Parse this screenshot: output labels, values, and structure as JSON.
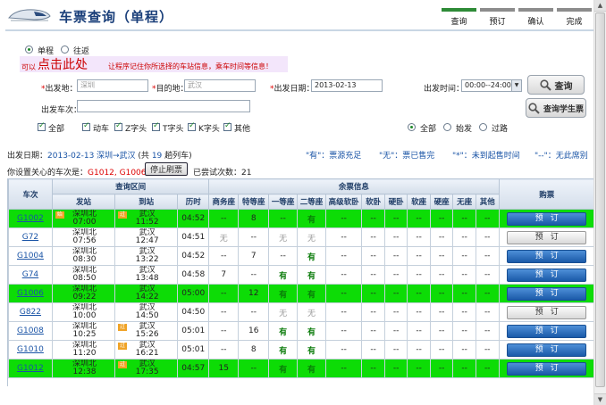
{
  "header": {
    "title": "车票查询（单程）",
    "steps": [
      "查询",
      "预订",
      "确认",
      "完成"
    ],
    "active_step": 0,
    "active_color": "#2e8b37"
  },
  "form": {
    "trip_one_way": "单程",
    "trip_round": "往返",
    "banner_prefix": "可以",
    "banner_big": "点击此处",
    "banner_rest": "让程序记住你所选择的车站信息，乘车时间等信息！",
    "from_label": "出发地：",
    "from_value": "深圳",
    "to_label": "目的地：",
    "to_value": "武汉",
    "date_label": "出发日期：",
    "date_value": "2013-02-13",
    "time_label": "出发时间：",
    "time_value": "00:00--24:00",
    "train_label": "出发车次：",
    "train_value": "",
    "query_button": "查询",
    "student_button": "查询学生票",
    "types": [
      "全部",
      "动车",
      "Z字头",
      "T字头",
      "K字头",
      "其他"
    ],
    "passing": [
      "全部",
      "始发",
      "过路"
    ]
  },
  "info": {
    "date_label": "出发日期：",
    "date_value": "2013-02-13",
    "route": "深圳→武汉",
    "count_prefix": "(共",
    "count": "19",
    "count_suffix": "趟列车)",
    "legend_have": "\"有\"：票源充足",
    "legend_none": "\"无\"：票已售完",
    "legend_star": "\"*\"：未到起售时间",
    "legend_dash": "\"--\"：无此席别",
    "watch_label": "你设置关心的车次是：",
    "watch_value": "G1012, G1006, G1002",
    "stop_button": "停止刷票",
    "tries_label": "已尝试次数：",
    "tries_value": "21"
  },
  "table": {
    "headers": {
      "train": "车次",
      "interval": "查询区间",
      "depart": "发站",
      "arrive": "到站",
      "duration": "历时",
      "seats_group": "余票信息",
      "book": "购票"
    },
    "seat_cols": [
      "商务座",
      "特等座",
      "一等座",
      "二等座",
      "高级软卧",
      "软卧",
      "硬卧",
      "软座",
      "硬座",
      "无座",
      "其他"
    ],
    "start_badge": "始",
    "pass_badge": "过",
    "book_label": "预订",
    "rows": [
      {
        "no": "G1002",
        "from": "深圳北",
        "dep": "07:00",
        "to": "武汉",
        "arr": "11:52",
        "dur": "04:52",
        "seats": [
          "--",
          "8",
          "--",
          "有",
          "--",
          "--",
          "--",
          "--",
          "--",
          "--",
          "--"
        ],
        "green": true
      },
      {
        "no": "G72",
        "from": "深圳北",
        "dep": "07:56",
        "to": "武汉",
        "arr": "12:47",
        "dur": "04:51",
        "seats": [
          "无",
          "--",
          "无",
          "无",
          "--",
          "--",
          "--",
          "--",
          "--",
          "--",
          "--"
        ],
        "green": false
      },
      {
        "no": "G1004",
        "from": "深圳北",
        "dep": "08:30",
        "to": "武汉",
        "arr": "13:22",
        "dur": "04:52",
        "seats": [
          "--",
          "7",
          "--",
          "有",
          "--",
          "--",
          "--",
          "--",
          "--",
          "--",
          "--"
        ],
        "green": false
      },
      {
        "no": "G74",
        "from": "深圳北",
        "dep": "08:50",
        "to": "武汉",
        "arr": "13:48",
        "dur": "04:58",
        "seats": [
          "7",
          "--",
          "有",
          "有",
          "--",
          "--",
          "--",
          "--",
          "--",
          "--",
          "--"
        ],
        "green": false
      },
      {
        "no": "G1006",
        "from": "深圳北",
        "dep": "09:22",
        "to": "武汉",
        "arr": "14:22",
        "dur": "05:00",
        "seats": [
          "--",
          "12",
          "有",
          "有",
          "--",
          "--",
          "--",
          "--",
          "--",
          "--",
          "--"
        ],
        "green": true
      },
      {
        "no": "G822",
        "from": "深圳北",
        "dep": "10:00",
        "to": "武汉",
        "arr": "14:50",
        "dur": "04:50",
        "seats": [
          "--",
          "--",
          "无",
          "无",
          "--",
          "--",
          "--",
          "--",
          "--",
          "--",
          "--"
        ],
        "green": false
      },
      {
        "no": "G1008",
        "from": "深圳北",
        "dep": "10:25",
        "to": "武汉",
        "arr": "15:26",
        "dur": "05:01",
        "seats": [
          "--",
          "16",
          "有",
          "有",
          "--",
          "--",
          "--",
          "--",
          "--",
          "--",
          "--"
        ],
        "green": false
      },
      {
        "no": "G1010",
        "from": "深圳北",
        "dep": "11:20",
        "to": "武汉",
        "arr": "16:21",
        "dur": "05:01",
        "seats": [
          "--",
          "8",
          "有",
          "有",
          "--",
          "--",
          "--",
          "--",
          "--",
          "--",
          "--"
        ],
        "green": false
      },
      {
        "no": "G1012",
        "from": "深圳北",
        "dep": "12:38",
        "to": "武汉",
        "arr": "17:35",
        "dur": "04:57",
        "seats": [
          "15",
          "--",
          "有",
          "有",
          "--",
          "--",
          "--",
          "--",
          "--",
          "--",
          "--"
        ],
        "green": true
      }
    ],
    "badges": [
      [
        "始",
        "过"
      ],
      [
        "",
        ""
      ],
      [
        "",
        ""
      ],
      [
        "",
        ""
      ],
      [
        "",
        ""
      ],
      [
        "",
        ""
      ],
      [
        "",
        "过"
      ],
      [
        "",
        "过"
      ],
      [
        "",
        "过"
      ]
    ],
    "grey_button_rows": [
      1,
      5
    ]
  }
}
